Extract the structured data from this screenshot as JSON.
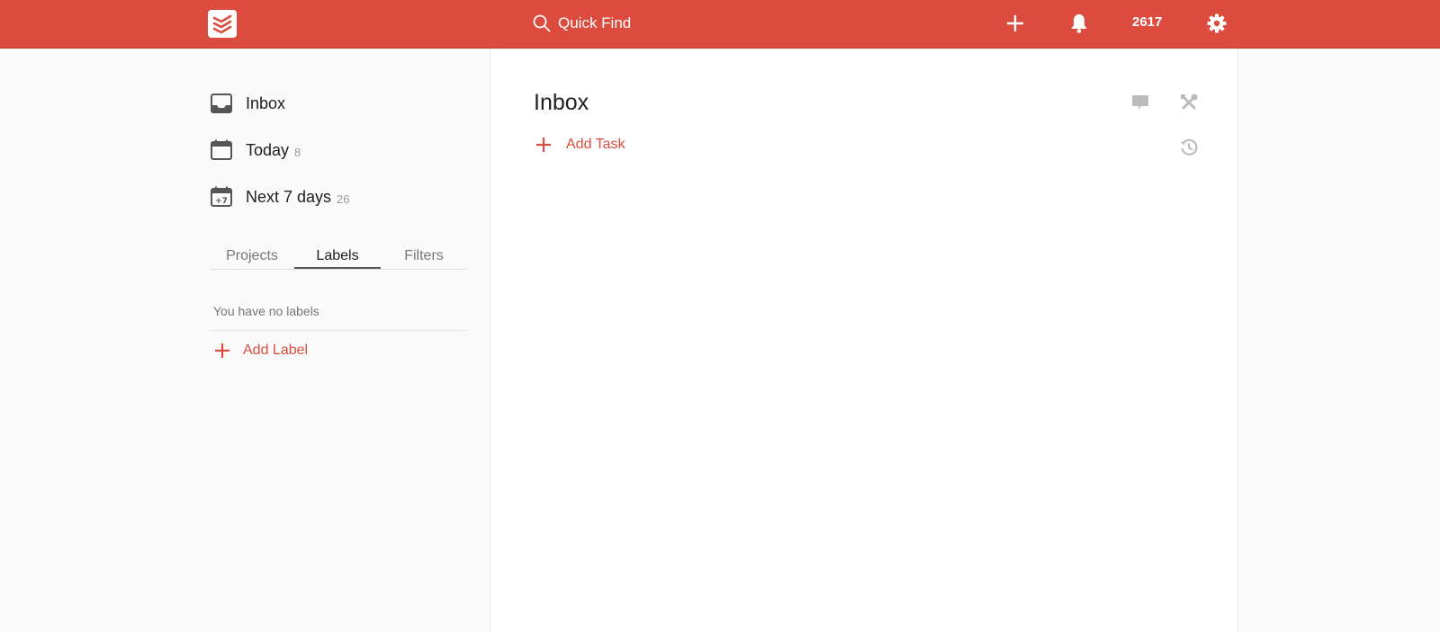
{
  "app": {
    "brand_color": "#db4c3f",
    "logo": "todoist-logo"
  },
  "topbar": {
    "search": {
      "icon": "search-icon",
      "placeholder": "Quick Find"
    },
    "add_icon": "plus-icon",
    "notifications_icon": "bell-icon",
    "karma": "2617",
    "settings_icon": "gear-icon"
  },
  "sidebar": {
    "nav": [
      {
        "label": "Inbox",
        "count": "",
        "icon": "inbox-icon"
      },
      {
        "label": "Today",
        "count": "8",
        "icon": "calendar-icon"
      },
      {
        "label": "Next 7 days",
        "count": "26",
        "icon": "calendar-plus7-icon"
      }
    ],
    "tabs": [
      {
        "label": "Projects",
        "active": false
      },
      {
        "label": "Labels",
        "active": true
      },
      {
        "label": "Filters",
        "active": false
      }
    ],
    "empty_message": "You have no labels",
    "add_label": "Add Label"
  },
  "main": {
    "title": "Inbox",
    "add_task": "Add Task",
    "actions": [
      "comment-icon",
      "tools-icon",
      "history-icon"
    ]
  }
}
